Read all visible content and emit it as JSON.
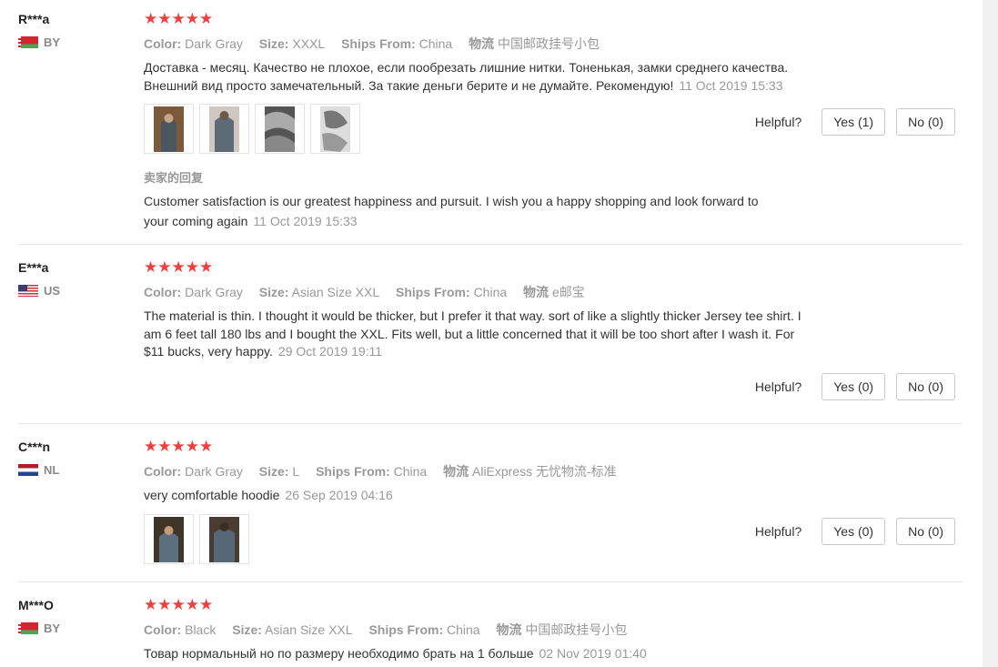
{
  "reviews": [
    {
      "user": "R***a",
      "country": "BY",
      "stars": "★★★★★",
      "color_label": "Color:",
      "color": "Dark Gray",
      "size_label": "Size:",
      "size": "XXXL",
      "ships_label": "Ships From:",
      "ships": "China",
      "logistics_label": "物流",
      "logistics": "中国邮政挂号小包",
      "text_line1": "Доставка - месяц. Качество не плохое, если пообрезать лишние нитки. Тоненькая, замки среднего качества.",
      "text_line2": "Внешний вид просто замечательный. За такие деньги берите и не думайте. Рекомендую!",
      "date": "11 Oct 2019 15:33",
      "reply_title": "卖家的回复",
      "reply_line1": "Customer satisfaction is our greatest happiness and pursuit. I wish you a happy shopping and look forward to",
      "reply_line2": "your coming again",
      "reply_date": "11 Oct 2019 15:33",
      "helpful": "Helpful?",
      "yes": "Yes (1)",
      "no": "No (0)"
    },
    {
      "user": "E***a",
      "country": "US",
      "stars": "★★★★★",
      "color_label": "Color:",
      "color": "Dark Gray",
      "size_label": "Size:",
      "size": "Asian Size XXL",
      "ships_label": "Ships From:",
      "ships": "China",
      "logistics_label": "物流",
      "logistics": "e邮宝",
      "text_line1": "The material is thin. I thought it would be thicker, but I prefer it that way. sort of like a slightly thicker Jersey tee shirt. I",
      "text_line2": "am 6 feet tall 180 lbs and I bought the XXL. Fits well, but a little concerned that it will be too short after I wash it. For",
      "text_line3": "$11 bucks, very happy.",
      "date": "29 Oct 2019 19:11",
      "helpful": "Helpful?",
      "yes": "Yes (0)",
      "no": "No (0)"
    },
    {
      "user": "C***n",
      "country": "NL",
      "stars": "★★★★★",
      "color_label": "Color:",
      "color": "Dark Gray",
      "size_label": "Size:",
      "size": "L",
      "ships_label": "Ships From:",
      "ships": "China",
      "logistics_label": "物流",
      "logistics": "AliExpress 无忧物流-标准",
      "text_line1": "very comfortable hoodie",
      "date": "26 Sep 2019 04:16",
      "helpful": "Helpful?",
      "yes": "Yes (0)",
      "no": "No (0)"
    },
    {
      "user": "M***O",
      "country": "BY",
      "stars": "★★★★★",
      "color_label": "Color:",
      "color": "Black",
      "size_label": "Size:",
      "size": "Asian Size XXL",
      "ships_label": "Ships From:",
      "ships": "China",
      "logistics_label": "物流",
      "logistics": "中国邮政挂号小包",
      "text_line1": "Товар нормальный но по размеру необходимо брать на 1 больше",
      "date": "02 Nov 2019 01:40"
    }
  ],
  "colors": {
    "star": "#f03f3f",
    "muted": "#999999",
    "text": "#333333",
    "divider": "#e6e6e6"
  }
}
